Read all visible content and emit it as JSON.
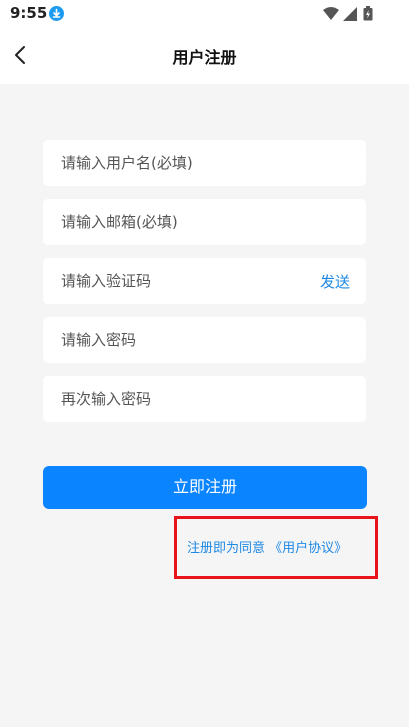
{
  "status_bar": {
    "time": "9:55",
    "icons": [
      "download-badge-icon",
      "wifi-icon",
      "signal-icon",
      "battery-icon"
    ]
  },
  "header": {
    "title": "用户注册",
    "back_icon": "chevron-left-icon"
  },
  "form": {
    "username_placeholder": "请输入用户名(必填)",
    "email_placeholder": "请输入邮箱(必填)",
    "code_placeholder": "请输入验证码",
    "send_label": "发送",
    "password_placeholder": "请输入密码",
    "confirm_password_placeholder": "再次输入密码"
  },
  "submit_label": "立即注册",
  "agreement": {
    "text": "注册即为同意 《用户协议》"
  },
  "colors": {
    "accent": "#0a84ff",
    "link": "#1e88e5",
    "highlight_border": "#e8131b",
    "background": "#f5f5f5"
  }
}
